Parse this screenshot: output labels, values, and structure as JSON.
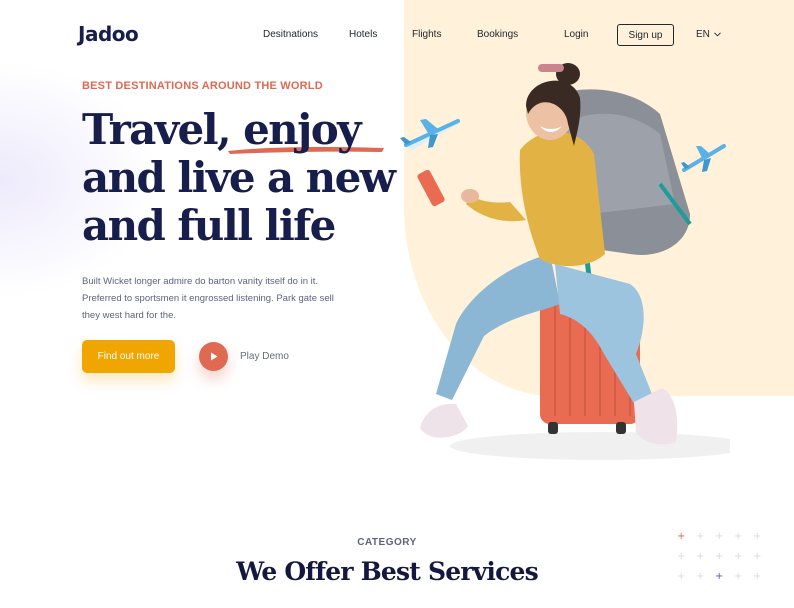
{
  "brand": {
    "logo_text": "Jadoo"
  },
  "nav": {
    "items": [
      "Desitnations",
      "Hotels",
      "Flights",
      "Bookings"
    ],
    "login": "Login",
    "signup": "Sign up",
    "language": "EN"
  },
  "hero": {
    "tagline": "BEST DESTINATIONS AROUND THE WORLD",
    "headline_lines": [
      "Travel, enjoy",
      "and live a new",
      "and full life"
    ],
    "description": "Built Wicket longer admire do barton vanity itself do in it. Preferred to sportsmen it engrossed listening. Park gate sell they west hard for the.",
    "cta_primary": "Find out more",
    "cta_secondary": "Play Demo"
  },
  "category": {
    "subtitle": "CATEGORY",
    "title": "We Offer Best Services"
  },
  "colors": {
    "brand_navy": "#181E4B",
    "accent_orange": "#DF6951",
    "accent_yellow": "#F1A501",
    "hero_bg": "#FFF1DA"
  },
  "icons": [
    "chevron-down-icon",
    "play-icon",
    "airplane-icon"
  ]
}
